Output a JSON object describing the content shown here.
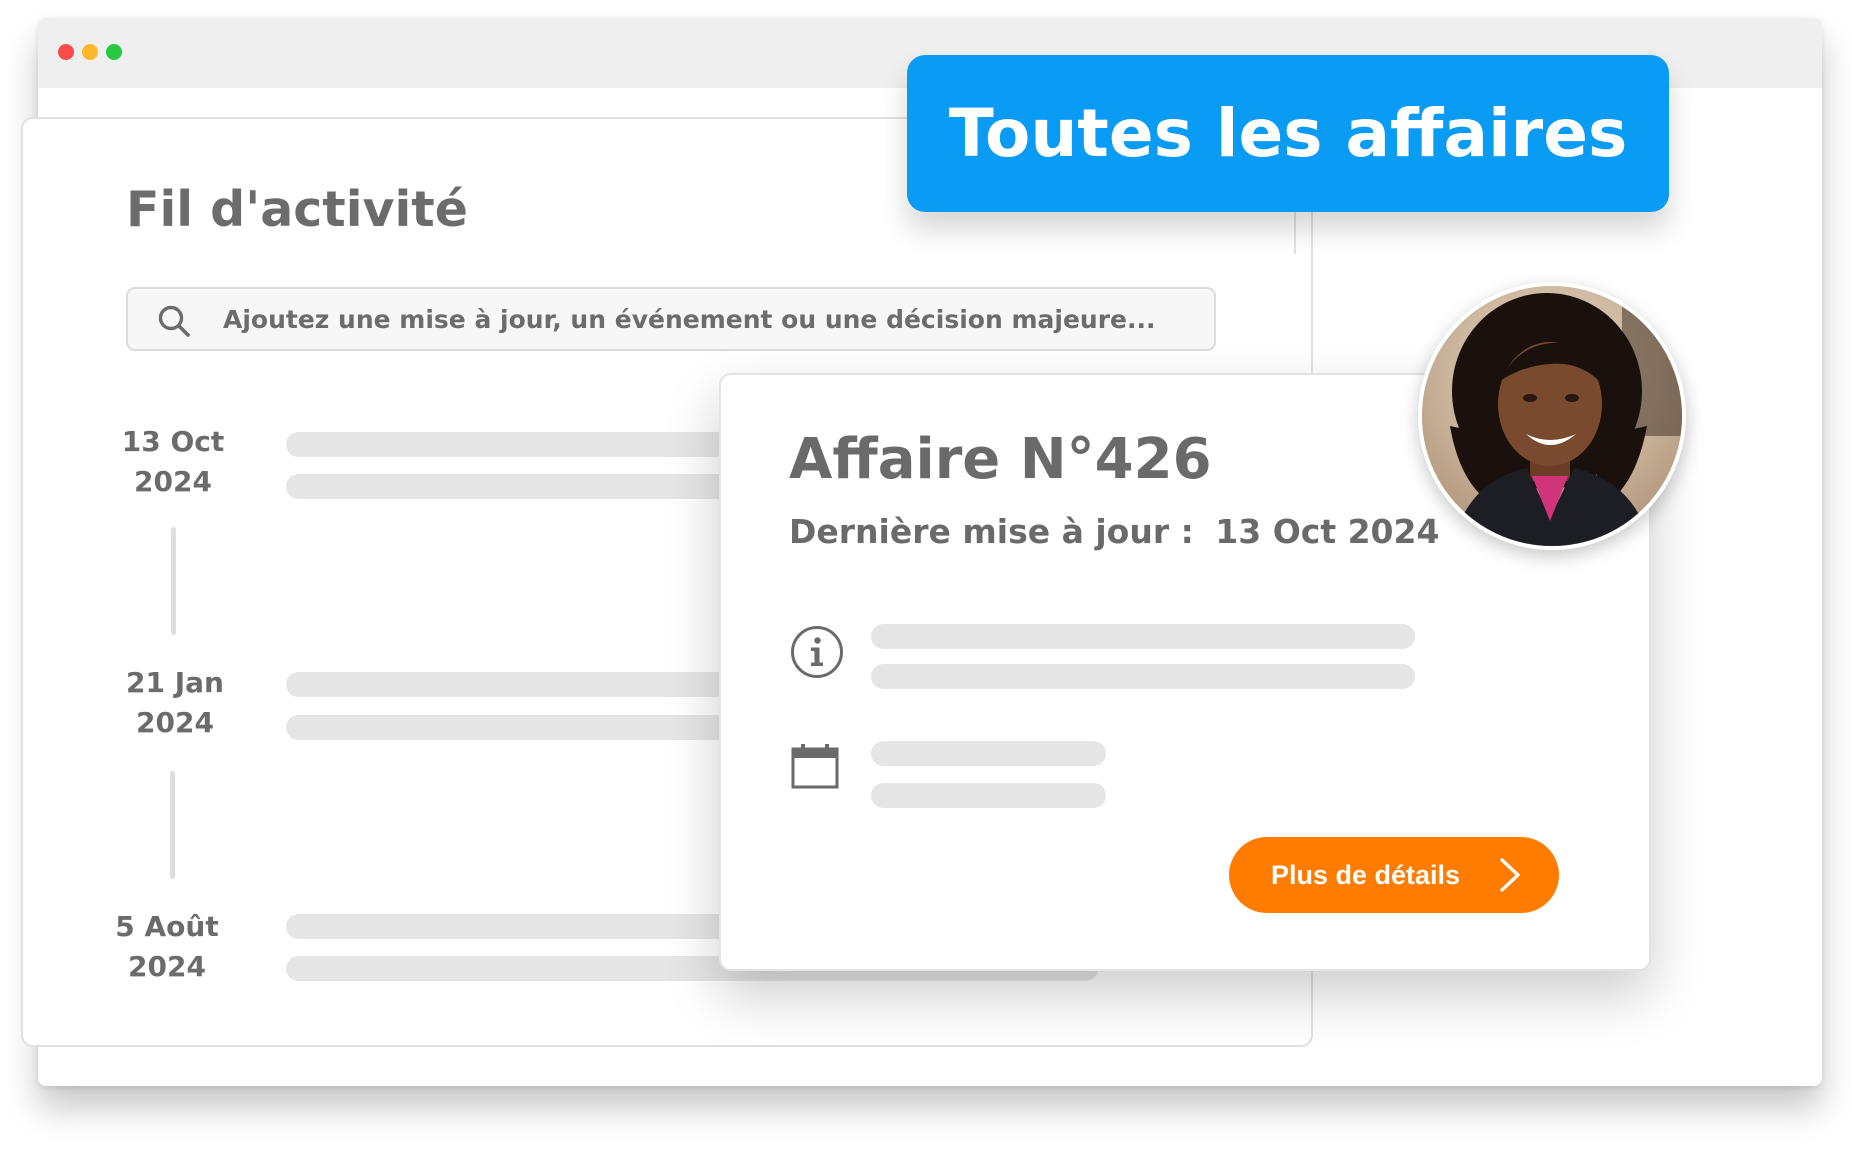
{
  "window": {
    "controls": [
      {
        "name": "close",
        "color": "#fc4b4b"
      },
      {
        "name": "minimize",
        "color": "#fdb92d"
      },
      {
        "name": "maximize",
        "color": "#27c93f"
      }
    ]
  },
  "banner": {
    "title": "Toutes les affaires",
    "color": "#0a9bf5"
  },
  "feed": {
    "title": "Fil d'activité",
    "search": {
      "placeholder": "Ajoutez une mise à jour, un événement ou une décision majeure...",
      "icon": "search-icon"
    },
    "entries": [
      {
        "day_month": "13 Oct",
        "year": "2024"
      },
      {
        "day_month": "21 Jan",
        "year": "2024"
      },
      {
        "day_month": "5 Août",
        "year": "2024"
      }
    ]
  },
  "case": {
    "title": "Affaire N°426",
    "updated_label": "Dernière mise à jour :",
    "updated_date": "13 Oct 2024",
    "icons": [
      "info-icon",
      "calendar-icon"
    ],
    "button": {
      "label": "Plus de détails",
      "icon": "chevron-right-icon",
      "color": "#ff7c00"
    }
  },
  "avatar": {
    "icon": "user-photo"
  }
}
